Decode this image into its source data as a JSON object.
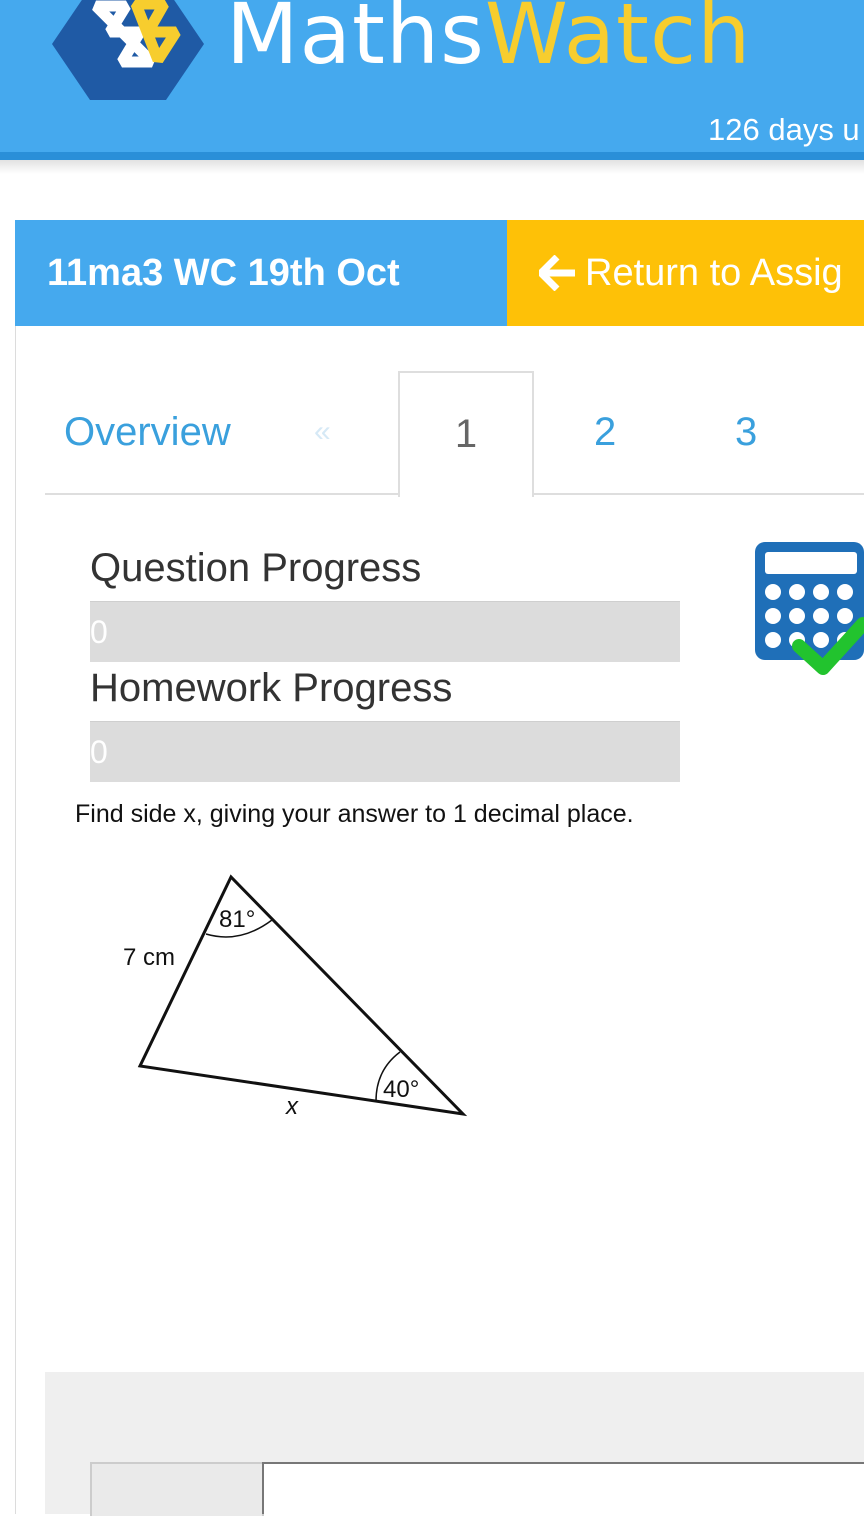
{
  "header": {
    "brand_part1": "Maths",
    "brand_part2": "Watch",
    "days_remaining_text": "126 days u",
    "colors": {
      "bar": "#45a9ee",
      "brand_yellow": "#f7cd2e",
      "logo_navy": "#1f5aa5"
    }
  },
  "assignment": {
    "title": "11ma3 WC 19th Oct",
    "return_label": "Return to Assig",
    "return_icon": "arrow-left-icon",
    "colors": {
      "title_bar": "#45a9ee",
      "return_button": "#fec107"
    }
  },
  "tabs": {
    "overview": "Overview",
    "prev": "«",
    "items": [
      "1",
      "2",
      "3"
    ],
    "active": "1"
  },
  "progress": {
    "question_label": "Question Progress",
    "question_value": "0",
    "question_fraction": 0,
    "homework_label": "Homework Progress",
    "homework_value": "0",
    "homework_fraction": 0
  },
  "calculator": {
    "icon": "calculator-allowed-icon",
    "check_color": "#22c32e"
  },
  "question": {
    "text": "Find side x, giving your answer to 1 decimal place.",
    "diagram": {
      "side_label": "7 cm",
      "angle_top": "81°",
      "angle_right": "40°",
      "unknown_side": "x"
    }
  }
}
